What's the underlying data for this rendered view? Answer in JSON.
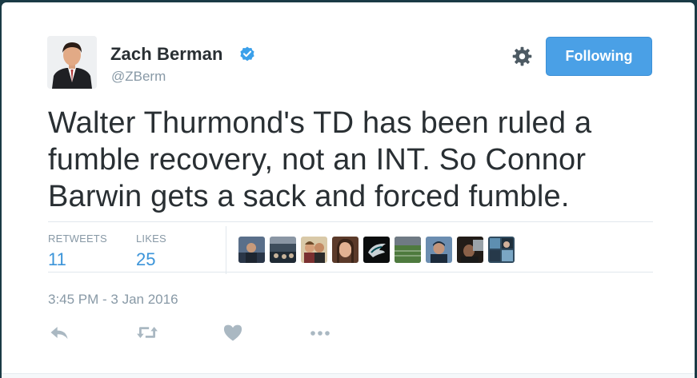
{
  "author": {
    "name": "Zach Berman",
    "handle": "@ZBerm",
    "verified": true,
    "avatar_icon": "avatar-photo"
  },
  "actions": {
    "settings_icon": "gear-icon",
    "follow_label": "Following"
  },
  "tweet": {
    "text": "Walter Thurmond's TD has been ruled a fumble recovery, not an INT. So Connor Barwin gets a sack and forced fumble."
  },
  "stats": {
    "retweets_label": "RETWEETS",
    "retweets_count": "11",
    "likes_label": "LIKES",
    "likes_count": "25"
  },
  "likers": [
    {
      "name": "liker-avatar-1"
    },
    {
      "name": "liker-avatar-2"
    },
    {
      "name": "liker-avatar-3"
    },
    {
      "name": "liker-avatar-4"
    },
    {
      "name": "liker-avatar-5"
    },
    {
      "name": "liker-avatar-6"
    },
    {
      "name": "liker-avatar-7"
    },
    {
      "name": "liker-avatar-8"
    },
    {
      "name": "liker-avatar-9"
    }
  ],
  "timestamp": "3:45 PM - 3 Jan 2016",
  "footer_actions": [
    "reply-icon",
    "retweet-icon",
    "like-icon",
    "more-icon"
  ],
  "colors": {
    "accent": "#4aa0e6",
    "link": "#3b94d9",
    "text": "#292f33",
    "muted": "#8899a6"
  }
}
